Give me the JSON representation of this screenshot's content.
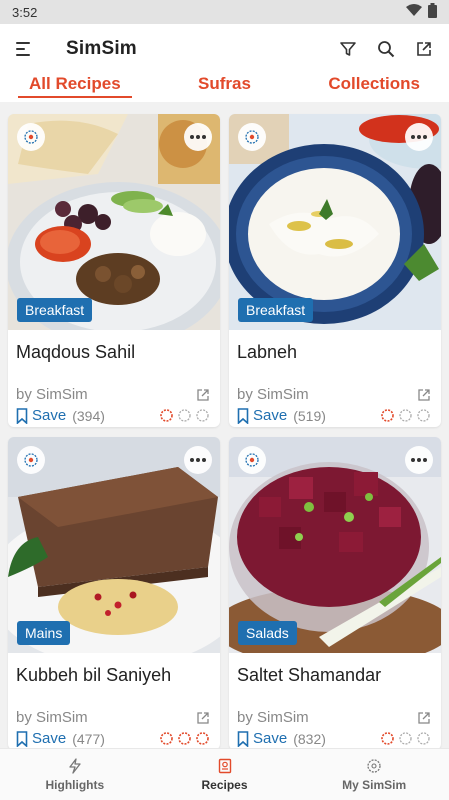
{
  "status_bar": {
    "time": "3:52"
  },
  "app_bar": {
    "title": "SimSim"
  },
  "tabs": [
    {
      "label": "All Recipes",
      "active": true
    },
    {
      "label": "Sufras",
      "active": false
    },
    {
      "label": "Collections",
      "active": false
    }
  ],
  "recipes": [
    {
      "category": "Breakfast",
      "name": "Maqdous Sahil",
      "author": "by SimSim",
      "save_label": "Save",
      "save_count": "(394)",
      "difficulty": 1,
      "image": "plate of mixed vegetables, olives, labneh and maqdous eggplants"
    },
    {
      "category": "Breakfast",
      "name": "Labneh",
      "author": "by SimSim",
      "save_label": "Save",
      "save_count": "(519)",
      "difficulty": 1,
      "image": "labneh with olive oil and mint on blue plate"
    },
    {
      "category": "Mains",
      "name": "Kubbeh bil Saniyeh",
      "author": "by SimSim",
      "save_label": "Save",
      "save_count": "(477)",
      "difficulty": 3,
      "image": "baked kubbeh slices with hummus and pomegranate"
    },
    {
      "category": "Salads",
      "name": "Saltet Shamandar",
      "author": "by SimSim",
      "save_label": "Save",
      "save_count": "(832)",
      "difficulty": 1,
      "image": "beetroot salad in glass bowl with spring onion"
    }
  ],
  "bottom_nav": [
    {
      "label": "Highlights",
      "icon": "lightning-icon",
      "active": false
    },
    {
      "label": "Recipes",
      "icon": "recipe-book-icon",
      "active": true
    },
    {
      "label": "My SimSim",
      "icon": "simsim-flower-icon",
      "active": false
    }
  ],
  "colors": {
    "accent": "#e24a2b",
    "brand_blue": "#1f6fb0"
  }
}
